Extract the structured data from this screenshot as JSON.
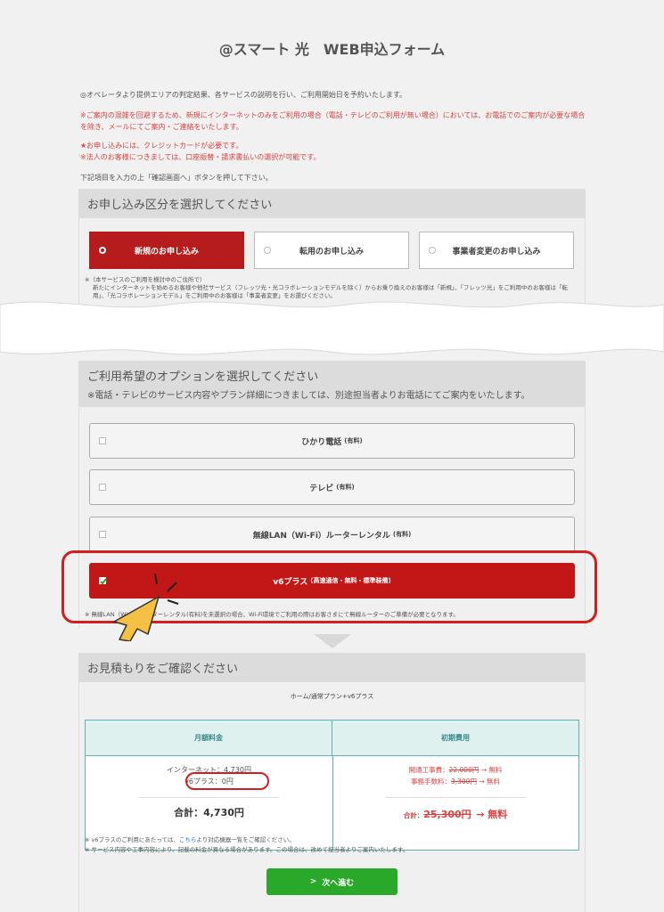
{
  "page_title": "@スマート 光　WEB申込フォーム",
  "intro": {
    "line1": "◎オペレータより提供エリアの判定結果、各サービスの説明を行い、ご利用開始日を予約いたします。",
    "warning1": "※ご案内の混雑を回避するため、新規にインターネットのみをご利用の場合（電話・テレビのご利用が無い場合）においては、お電話でのご案内が必要な場合を除き、メールにてご案内・ご連絡をいたします。",
    "warning2": "★お申し込みには、クレジットカードが必要です。",
    "warning3": "※法人のお客様につきましては、口座振替・請求書払いの選択が可能です。",
    "instruction": "下記項目を入力の上「確認画面へ」ボタンを押して下さい。"
  },
  "application_type": {
    "heading": "お申し込み区分を選択してください",
    "options": [
      "新規のお申し込み",
      "転用のお申し込み",
      "事業者変更のお申し込み"
    ],
    "note_line1": "※（本サービスのご利用を検討中のご住所で）",
    "note_line2": "新たにインターネットを始めるお客様や他社サービス（フレッツ光・光コラボレーションモデルを除く）からお乗り換えのお客様は「新規」、「フレッツ光」をご利用中のお客様は「転用」、「光コラボレーションモデル」をご利用中のお客様は「事業者変更」をお選びください。"
  },
  "options_section": {
    "heading": "ご利用希望のオプションを選択してください",
    "subheading": "※電話・テレビのサービス内容やプラン詳細につきましては、別途担当者よりお電話にてご案内をいたします。",
    "items": [
      {
        "label": "ひかり電話",
        "tag": "(有料)"
      },
      {
        "label": "テレビ",
        "tag": "(有料)"
      },
      {
        "label": "無線LAN（Wi-Fi）ルーターレンタル",
        "tag": "(有料)"
      },
      {
        "label": "v6プラス",
        "tag": "(高速通信・無料・標準装備)"
      }
    ],
    "note": "※ 無線LAN（Wi-Fi）ルーターレンタル(有料)を未選択の場合、Wi-Fi環境でご利用の際はお客さまにて無線ルーターのご準備が必要となります。"
  },
  "estimate": {
    "heading": "お見積もりをご確認ください",
    "plan": "ホーム/通常プラン+v6プラス",
    "monthly": {
      "header": "月額料金",
      "internet": "インターネット：4,730円",
      "v6": "v6プラス：0円",
      "total": "合計：4,730円"
    },
    "initial": {
      "header": "初期費用",
      "line1_label": "開通工事費：",
      "line1_old": "22,000円",
      "line1_new": "→ 無料",
      "line2_label": "事務手数料：",
      "line2_old": "3,300円",
      "line2_new": "→ 無料",
      "total_label": "合計：",
      "total_old": "25,300円",
      "total_new": "→ 無料"
    },
    "note1_prefix": "※ v6プラスのご利用にあたっては、",
    "note1_link": "こちら",
    "note1_suffix": "より対応機器一覧をご確認ください。",
    "note2": "※ サービス内容や工事内容により、記載の料金が異なる場合があります。この場合は、改めて担当者よりご案内いたします。"
  },
  "next_button": "次へ進む",
  "colors": {
    "accent_red": "#c21717",
    "highlight_red": "#d11f1f",
    "green": "#29a829",
    "teal": "#3a8a8a"
  }
}
